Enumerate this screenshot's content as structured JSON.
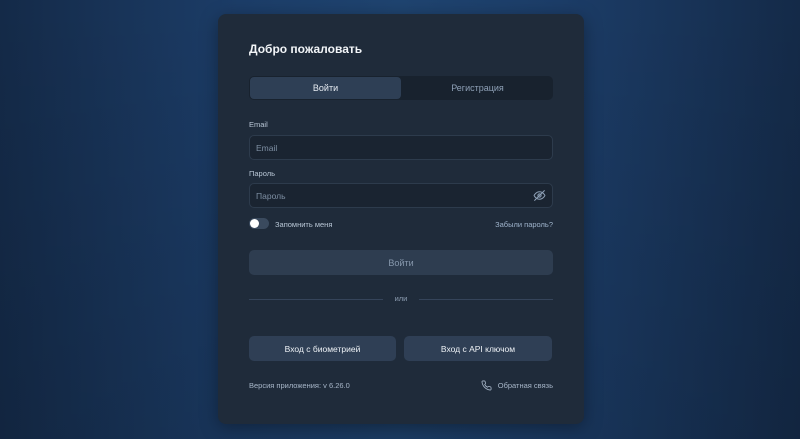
{
  "auth": {
    "title": "Добро пожаловать",
    "tabs": [
      {
        "label": "Войти",
        "active": true
      },
      {
        "label": "Регистрация",
        "active": false
      }
    ],
    "email": {
      "label": "Email",
      "placeholder": "Email",
      "value": ""
    },
    "password": {
      "label": "Пароль",
      "placeholder": "Пароль",
      "value": "",
      "icon": "eye-off-icon"
    },
    "remember": {
      "label": "Запомнить меня",
      "checked": false
    },
    "forgot_label": "Забыли пароль?",
    "submit_label": "Войти",
    "divider_label": "или",
    "biometric_label": "Вход с биометрией",
    "api_key_label": "Вход с API ключом",
    "version_label": "Версия приложения: v 6.26.0",
    "feedback": {
      "label": "Обратная связь",
      "icon": "phone-icon"
    }
  },
  "colors": {
    "background": "#1c3d68",
    "card": "#1f2b3a",
    "button": "#2f3f55",
    "accent_text": "#9fb4cc"
  }
}
